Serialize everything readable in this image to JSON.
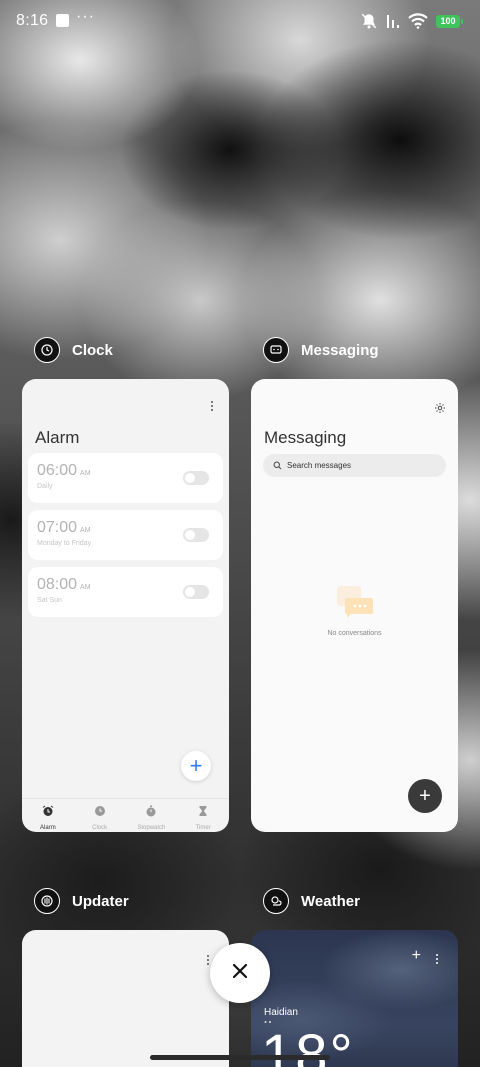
{
  "status_bar": {
    "time": "8:16",
    "dots": "···",
    "battery": "100",
    "battery_color": "#3fc35a"
  },
  "recents": [
    {
      "app_name": "Clock",
      "icon": "clock-app-icon",
      "screen": {
        "title": "Alarm",
        "alarms": [
          {
            "time": "06:00",
            "ampm": "AM",
            "repeat": "Daily",
            "enabled": false
          },
          {
            "time": "07:00",
            "ampm": "AM",
            "repeat": "Monday to Friday",
            "enabled": false
          },
          {
            "time": "08:00",
            "ampm": "AM",
            "repeat": "Sat Sun",
            "enabled": false
          }
        ],
        "fab": "+",
        "tabs": [
          {
            "label": "Alarm",
            "icon": "alarm-icon",
            "active": true
          },
          {
            "label": "Clock",
            "icon": "clock-icon",
            "active": false
          },
          {
            "label": "Stopwatch",
            "icon": "stopwatch-icon",
            "active": false
          },
          {
            "label": "Timer",
            "icon": "hourglass-icon",
            "active": false
          }
        ]
      }
    },
    {
      "app_name": "Messaging",
      "icon": "messaging-app-icon",
      "screen": {
        "title": "Messaging",
        "search_placeholder": "Search messages",
        "empty_text": "No conversations",
        "fab": "+"
      }
    },
    {
      "app_name": "Updater",
      "icon": "updater-app-icon"
    },
    {
      "app_name": "Weather",
      "icon": "weather-app-icon",
      "screen": {
        "plus": "+",
        "city": "Haidian",
        "temperature": "18°"
      }
    }
  ],
  "accent_color": "#2f7df6"
}
